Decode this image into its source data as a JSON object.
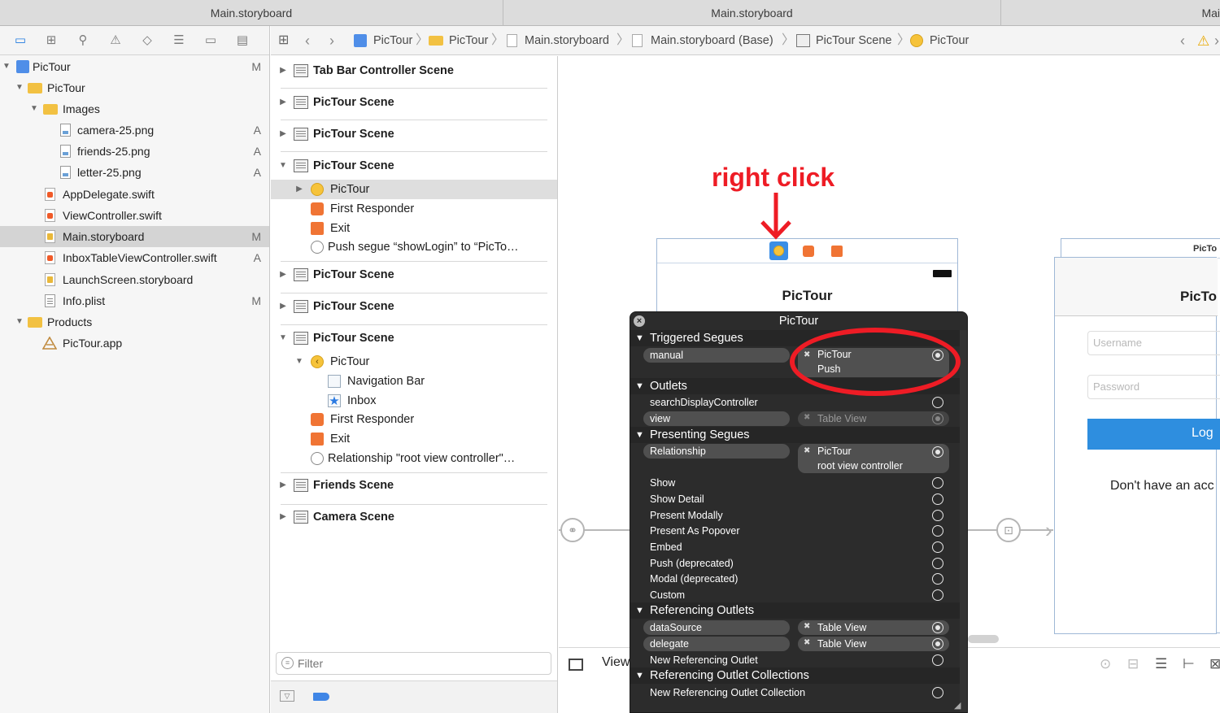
{
  "tabs": [
    "Main.storyboard",
    "Main.storyboard",
    "Mai"
  ],
  "navigator": {
    "items": [
      {
        "label": "PicTour",
        "badge": "M"
      },
      {
        "label": "PicTour",
        "badge": ""
      },
      {
        "label": "Images",
        "badge": ""
      },
      {
        "label": "camera-25.png",
        "badge": "A"
      },
      {
        "label": "friends-25.png",
        "badge": "A"
      },
      {
        "label": "letter-25.png",
        "badge": "A"
      },
      {
        "label": "AppDelegate.swift",
        "badge": ""
      },
      {
        "label": "ViewController.swift",
        "badge": ""
      },
      {
        "label": "Main.storyboard",
        "badge": "M"
      },
      {
        "label": "InboxTableViewController.swift",
        "badge": "A"
      },
      {
        "label": "LaunchScreen.storyboard",
        "badge": ""
      },
      {
        "label": "Info.plist",
        "badge": "M"
      },
      {
        "label": "Products",
        "badge": ""
      },
      {
        "label": "PicTour.app",
        "badge": ""
      }
    ]
  },
  "jumpbar": {
    "crumbs": [
      "PicTour",
      "PicTour",
      "Main.storyboard",
      "Main.storyboard (Base)",
      "PicTour Scene",
      "PicTour"
    ]
  },
  "outline": {
    "scenes": [
      "Tab Bar Controller Scene",
      "PicTour Scene",
      "PicTour Scene",
      "PicTour Scene",
      "PicTour Scene",
      "PicTour Scene",
      "PicTour Scene",
      "Friends Scene",
      "Camera Scene"
    ],
    "scene4_children": [
      "PicTour",
      "First Responder",
      "Exit",
      "Push segue “showLogin” to “PicTo…"
    ],
    "scene7_children": [
      "PicTour",
      "Navigation Bar",
      "Inbox",
      "First Responder",
      "Exit",
      "Relationship \"root view controller\"…"
    ],
    "filter_placeholder": "Filter"
  },
  "canvas": {
    "annotation": "right click",
    "scene_title": "PicTour",
    "scene_label_right": "PicTo",
    "right_title": "PicTo",
    "username_placeholder": "Username",
    "password_placeholder": "Password",
    "login_button": "Log",
    "signup_text": "Don't have an acc",
    "bottom_label": "View"
  },
  "popup": {
    "title": "PicTour",
    "sections": {
      "triggered": "Triggered Segues",
      "outlets": "Outlets",
      "presenting": "Presenting Segues",
      "referencing": "Referencing Outlets",
      "collections": "Referencing Outlet Collections"
    },
    "triggered_row": {
      "name": "manual",
      "target": "PicTour",
      "target2": "Push"
    },
    "outlets_rows": [
      {
        "name": "searchDisplayController",
        "target": ""
      },
      {
        "name": "view",
        "target": "Table View"
      }
    ],
    "presenting_relationship": {
      "name": "Relationship",
      "target": "PicTour",
      "target2": "root view controller"
    },
    "presenting_rows": [
      "Show",
      "Show Detail",
      "Present Modally",
      "Present As Popover",
      "Embed",
      "Push (deprecated)",
      "Modal (deprecated)",
      "Custom"
    ],
    "referencing_rows": [
      {
        "name": "dataSource",
        "target": "Table View"
      },
      {
        "name": "delegate",
        "target": "Table View"
      },
      {
        "name": "New Referencing Outlet",
        "target": ""
      }
    ],
    "collections_row": "New Referencing Outlet Collection"
  }
}
